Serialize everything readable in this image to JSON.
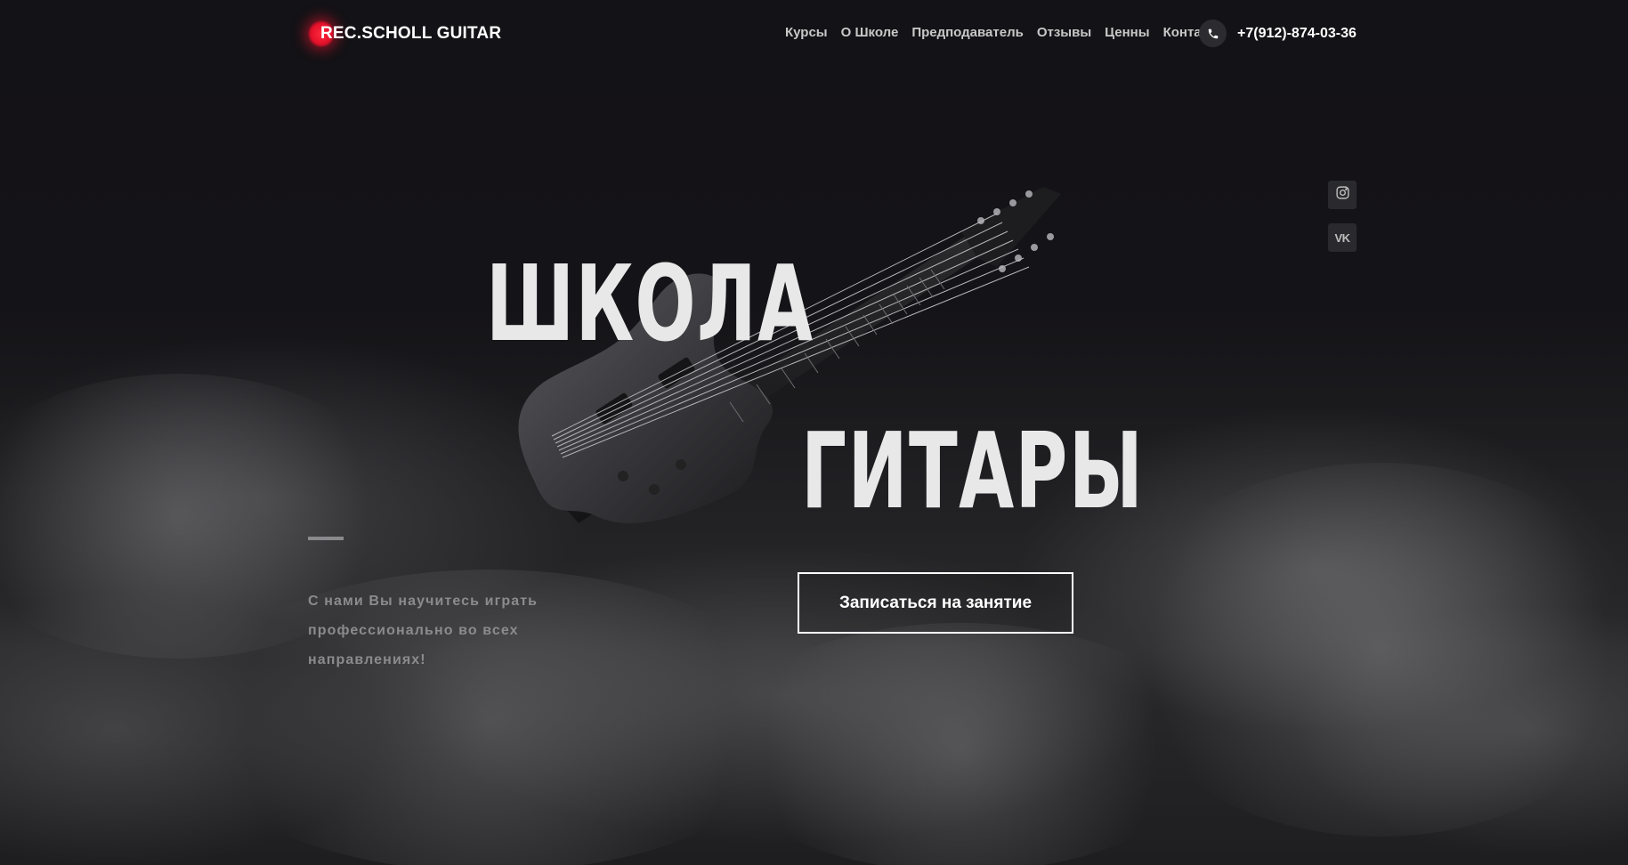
{
  "header": {
    "logo_text": "REC.SCHOLL GUITAR",
    "nav": [
      {
        "label": "Курсы"
      },
      {
        "label": "О Школе"
      },
      {
        "label": "Предподаватель"
      },
      {
        "label": "Отзывы"
      },
      {
        "label": "Ценны"
      },
      {
        "label": "Контакты"
      }
    ],
    "phone": "+7(912)-874-03-36"
  },
  "hero": {
    "title_line_1": "ШКОЛА",
    "title_line_2": "ГИТАРЫ",
    "subtitle": "С нами Вы научитесь играть профессионально во всех направлениях!",
    "cta_label": "Записаться на занятие"
  },
  "social": {
    "icons": [
      "instagram-icon",
      "vk-icon"
    ],
    "vk_text": "VK"
  },
  "colors": {
    "background": "#131216",
    "accent": "#e3102a",
    "text": "#ffffff"
  }
}
